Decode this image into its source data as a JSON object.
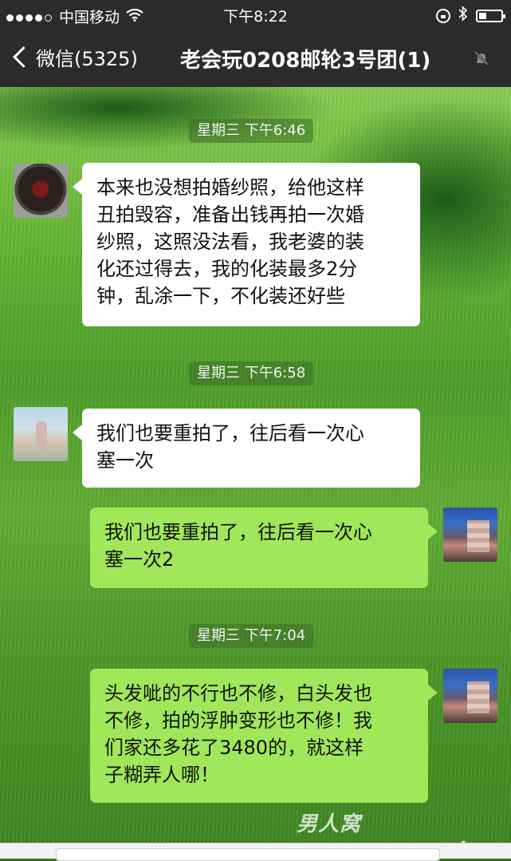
{
  "status_bar": {
    "carrier": "中国移动",
    "time": "下午8:22"
  },
  "nav": {
    "back_label": "微信(5325)",
    "title": "老会玩0208邮轮3号团(1)"
  },
  "messages": [
    {
      "type": "timestamp",
      "text": "星期三 下午6:46"
    },
    {
      "type": "incoming",
      "lines": [
        "本来也没想拍婚纱照，给他这样",
        "丑拍毁容，准备出钱再拍一次婚",
        "纱照，这照没法看，我老婆的装",
        "化还过得去，我的化装最多2分",
        "钟，乱涂一下，不化装还好些"
      ]
    },
    {
      "type": "timestamp",
      "text": "星期三 下午6:58"
    },
    {
      "type": "incoming",
      "lines": [
        "我们也要重拍了，往后看一次心",
        "塞一次"
      ]
    },
    {
      "type": "outgoing",
      "lines": [
        "我们也要重拍了，往后看一次心",
        "塞一次2"
      ]
    },
    {
      "type": "timestamp",
      "text": "星期三 下午7:04"
    },
    {
      "type": "outgoing",
      "lines": [
        "头发呲的不行也不修，白头发也",
        "不修，拍的浮肿变形也不修！我",
        "们家还多花了3480的，就这样",
        "子糊弄人哪！"
      ]
    }
  ],
  "watermark": "男人窝nanrenwo.net",
  "colors": {
    "bar_bg": "#2b2b2b",
    "incoming_bubble": "#ffffff",
    "outgoing_bubble": "#a0e75a"
  },
  "icons": [
    "signal-dots-icon",
    "wifi-icon",
    "orientation-lock-icon",
    "bluetooth-icon",
    "battery-icon",
    "back-chevron-icon",
    "mute-icon"
  ]
}
